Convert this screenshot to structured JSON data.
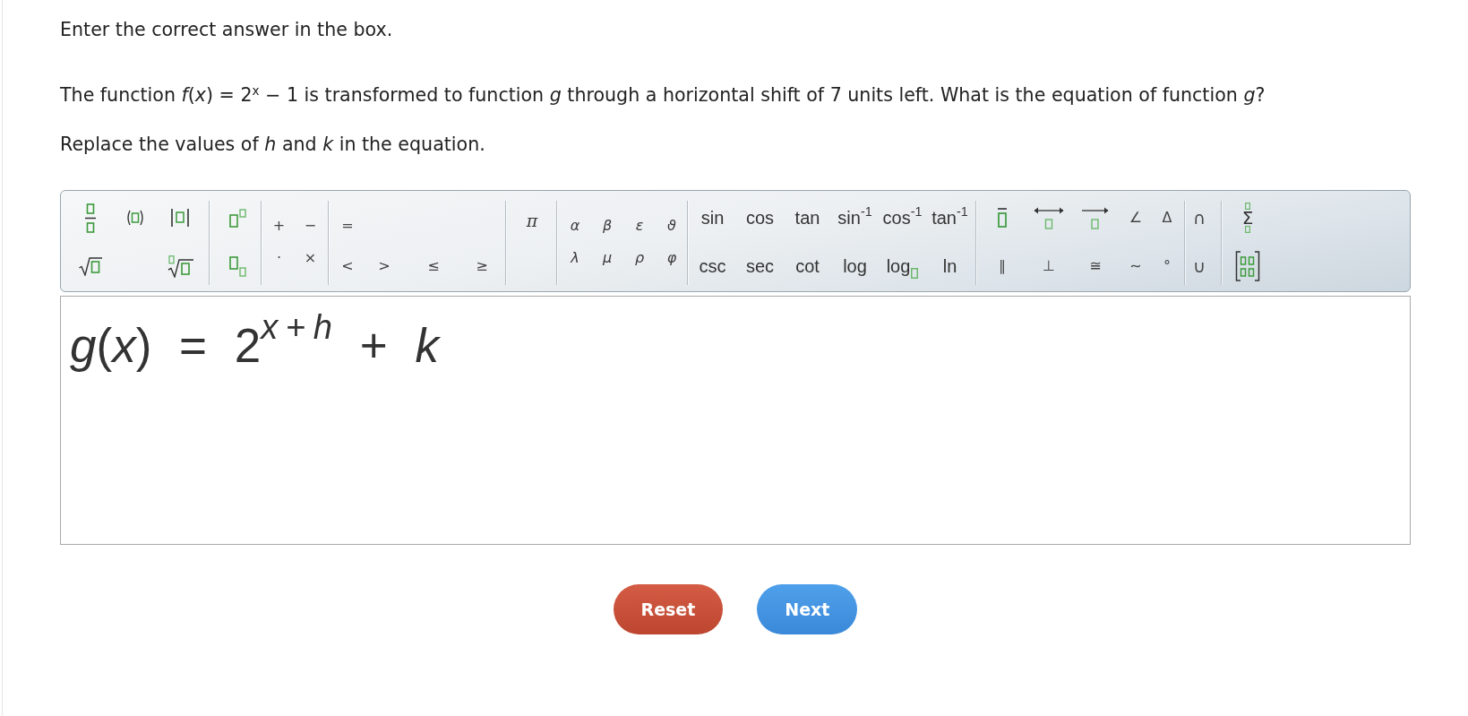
{
  "instruction": "Enter the correct answer in the box.",
  "question": "The function *f*(*x*) = 2$^{x}$ − 1 is transformed to function *g* through a horizontal shift of 7 units left. What is the equation of function *g*?",
  "hint": "Replace the values of *h* and *k* in the equation.",
  "toolbar": {
    "groups": [
      {
        "rows": [
          [
            {
              "kind": "fraction"
            },
            {
              "kind": "parentheses"
            },
            {
              "kind": "absolute-value"
            }
          ],
          [
            {
              "kind": "square-root"
            },
            {
              "kind": "nth-root"
            }
          ]
        ]
      },
      {
        "rows": [
          [
            {
              "kind": "superscript"
            }
          ],
          [
            {
              "kind": "subscript"
            }
          ]
        ]
      },
      {
        "rows": [
          [
            {
              "kind": "symbol",
              "label": "+"
            },
            {
              "kind": "symbol",
              "label": "−"
            }
          ],
          [
            {
              "kind": "symbol",
              "label": "·"
            },
            {
              "kind": "symbol",
              "label": "×"
            }
          ]
        ]
      },
      {
        "rows": [
          [
            {
              "kind": "symbol",
              "label": "="
            }
          ],
          [
            {
              "kind": "symbol",
              "label": "<"
            },
            {
              "kind": "symbol",
              "label": ">"
            },
            {
              "kind": "symbol",
              "label": "≤"
            },
            {
              "kind": "symbol",
              "label": "≥"
            }
          ]
        ]
      },
      {
        "rows": [
          [
            {
              "kind": "greek",
              "label": "π"
            }
          ]
        ]
      },
      {
        "rows": [
          [
            {
              "kind": "greek",
              "label": "α"
            },
            {
              "kind": "greek",
              "label": "β"
            },
            {
              "kind": "greek",
              "label": "ε"
            },
            {
              "kind": "greek",
              "label": "ϑ"
            }
          ],
          [
            {
              "kind": "greek",
              "label": "λ"
            },
            {
              "kind": "greek",
              "label": "μ"
            },
            {
              "kind": "greek",
              "label": "ρ"
            },
            {
              "kind": "greek",
              "label": "φ"
            }
          ]
        ]
      },
      {
        "rows": [
          [
            {
              "kind": "function",
              "label": "sin"
            },
            {
              "kind": "function",
              "label": "cos"
            },
            {
              "kind": "function",
              "label": "tan"
            },
            {
              "kind": "function",
              "label": "sin$^{-1}$"
            },
            {
              "kind": "function",
              "label": "cos$^{-1}$"
            },
            {
              "kind": "function",
              "label": "tan$^{-1}$"
            }
          ],
          [
            {
              "kind": "function",
              "label": "csc"
            },
            {
              "kind": "function",
              "label": "sec"
            },
            {
              "kind": "function",
              "label": "cot"
            },
            {
              "kind": "function",
              "label": "log"
            },
            {
              "kind": "log-base",
              "label": "log"
            },
            {
              "kind": "function",
              "label": "ln"
            }
          ]
        ]
      },
      {
        "rows": [
          [
            {
              "kind": "overline"
            },
            {
              "kind": "line"
            },
            {
              "kind": "ray"
            },
            {
              "kind": "symbol",
              "label": "∠"
            },
            {
              "kind": "symbol",
              "label": "Δ"
            }
          ],
          [
            {
              "kind": "symbol",
              "label": "∥"
            },
            {
              "kind": "symbol",
              "label": "⊥"
            },
            {
              "kind": "symbol",
              "label": "≅"
            },
            {
              "kind": "symbol",
              "label": "∼"
            },
            {
              "kind": "symbol",
              "label": "°"
            }
          ]
        ]
      },
      {
        "rows": [
          [
            {
              "kind": "symbol",
              "label": "∩"
            }
          ],
          [
            {
              "kind": "symbol",
              "label": "∪"
            }
          ]
        ]
      },
      {
        "rows": [
          [
            {
              "kind": "sum",
              "label": "Σ"
            }
          ],
          [
            {
              "kind": "matrix"
            }
          ]
        ]
      }
    ]
  },
  "answer": {
    "value": "*g*(*x*) = 2$^{x + h}$ + *k*"
  },
  "buttons": [
    {
      "kind": "reset",
      "label": "Reset"
    },
    {
      "kind": "next",
      "label": "Next"
    }
  ]
}
